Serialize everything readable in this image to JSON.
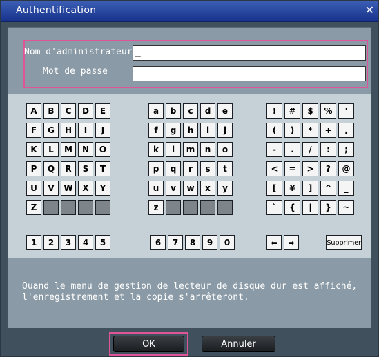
{
  "dialog": {
    "title": "Authentification",
    "close_glyph": "✕"
  },
  "credentials": {
    "admin_label": "Nom d'administrateur",
    "admin_value": "_",
    "password_label": "Mot de passe",
    "password_value": ""
  },
  "keyboard": {
    "uppercase": [
      "A",
      "B",
      "C",
      "D",
      "E",
      "F",
      "G",
      "H",
      "I",
      "J",
      "K",
      "L",
      "M",
      "N",
      "O",
      "P",
      "Q",
      "R",
      "S",
      "T",
      "U",
      "V",
      "W",
      "X",
      "Y",
      "Z"
    ],
    "lowercase": [
      "a",
      "b",
      "c",
      "d",
      "e",
      "f",
      "g",
      "h",
      "i",
      "j",
      "k",
      "l",
      "m",
      "n",
      "o",
      "p",
      "q",
      "r",
      "s",
      "t",
      "u",
      "v",
      "w",
      "x",
      "y",
      "z"
    ],
    "symbols": [
      "!",
      "#",
      "$",
      "%",
      "'",
      "(",
      ")",
      "*",
      "+",
      ",",
      "-",
      ".",
      "/",
      ":",
      ";",
      "<",
      "=",
      ">",
      "?",
      "@",
      "[",
      "¥",
      "]",
      "^",
      "_",
      "`",
      "{",
      "|",
      "}",
      "~"
    ],
    "digits_left": [
      "1",
      "2",
      "3",
      "4",
      "5"
    ],
    "digits_right": [
      "6",
      "7",
      "8",
      "9",
      "0"
    ],
    "arrow_left": "⬅",
    "arrow_right": "➡",
    "delete_label": "Supprimer"
  },
  "message": "Quand le menu de gestion de lecteur de disque dur est affiché,\nl'enregistrement et la copie s'arrêteront.",
  "buttons": {
    "ok": "OK",
    "cancel": "Annuler"
  },
  "colors": {
    "highlight": "#e0559a",
    "titlebar": "#17328c"
  }
}
